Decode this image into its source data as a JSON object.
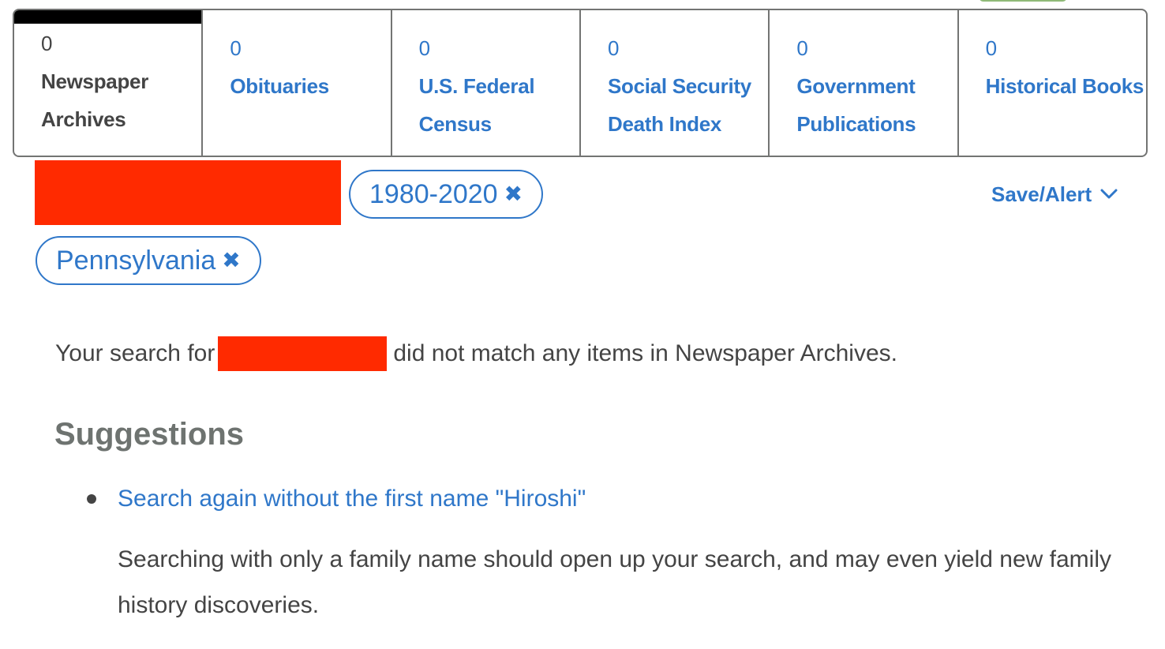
{
  "tabs": [
    {
      "count": "0",
      "label": "Newspaper Archives",
      "active": true
    },
    {
      "count": "0",
      "label": "Obituaries",
      "active": false
    },
    {
      "count": "0",
      "label": "U.S. Federal Census",
      "active": false
    },
    {
      "count": "0",
      "label": "Social Security Death Index",
      "active": false
    },
    {
      "count": "0",
      "label": "Government Publications",
      "active": false
    },
    {
      "count": "0",
      "label": "Historical Books",
      "active": false
    }
  ],
  "filters": {
    "date_range": {
      "label": "1980-2020",
      "remove_icon": "close-icon"
    },
    "location": {
      "label": "Pennsylvania",
      "remove_icon": "close-icon"
    }
  },
  "save_alert": {
    "label": "Save/Alert",
    "icon": "chevron-down-icon"
  },
  "message": {
    "prefix": "Your search for",
    "suffix": "did not match any items in Newspaper Archives."
  },
  "suggestions": {
    "title": "Suggestions",
    "items": [
      {
        "link": "Search again without the first name \"Hiroshi\"",
        "description": "Searching with only a family name should open up your search, and may even yield new family history discoveries."
      }
    ]
  },
  "colors": {
    "link": "#2f77c9",
    "text": "#444444",
    "heading": "#6e7370",
    "border": "#737473",
    "redaction": "#ff2a00"
  }
}
